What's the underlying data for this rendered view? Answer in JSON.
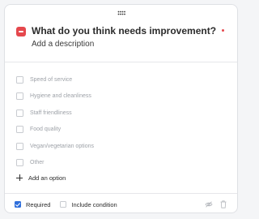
{
  "question": {
    "title": "What do you think needs improvement?",
    "description": "Add a description",
    "required": true,
    "accent_color": "#e5484d"
  },
  "options": [
    "Speed of service",
    "Hygiene and cleanliness",
    "Staff friendliness",
    "Food quality",
    "Vegan/vegetarian options",
    "Other"
  ],
  "add_option_label": "Add an option",
  "footer": {
    "required_label": "Required",
    "required_checked": true,
    "condition_label": "Include condition",
    "condition_checked": false,
    "checkbox_color": "#2f6fdb",
    "icons": [
      "visibility-off-icon",
      "trash-icon"
    ]
  }
}
